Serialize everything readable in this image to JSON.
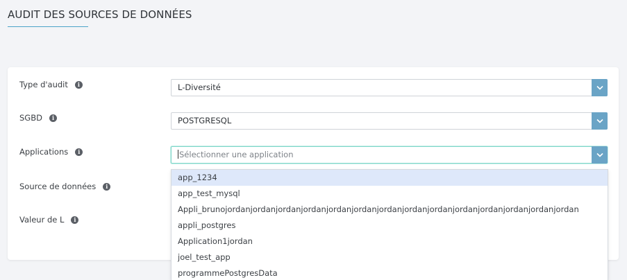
{
  "page": {
    "title": "AUDIT DES SOURCES DE DONNÉES"
  },
  "form": {
    "audit_type": {
      "label": "Type d'audit",
      "value": "L-Diversité"
    },
    "sgbd": {
      "label": "SGBD",
      "value": "POSTGRESQL"
    },
    "applications": {
      "label": "Applications",
      "placeholder": "Sélectionner une application"
    },
    "data_source": {
      "label": "Source de données"
    },
    "l_value": {
      "label": "Valeur de L"
    },
    "info_icon_glyph": "i"
  },
  "dropdown": {
    "options": [
      "app_1234",
      "app_test_mysql",
      "Appli_brunojordanjordanjordanjordanjordanjordanjordanjordanjordanjordanjordanjordanjordanjordan",
      "appli_postgres",
      "Application1jordan",
      "joel_test_app",
      "programmePostgresData"
    ],
    "highlighted_index": 0
  },
  "colors": {
    "accent": "#4aa3c8",
    "select_button": "#6aa4c6",
    "highlight": "#dee8fa",
    "focus_border": "#7fd6c9"
  }
}
